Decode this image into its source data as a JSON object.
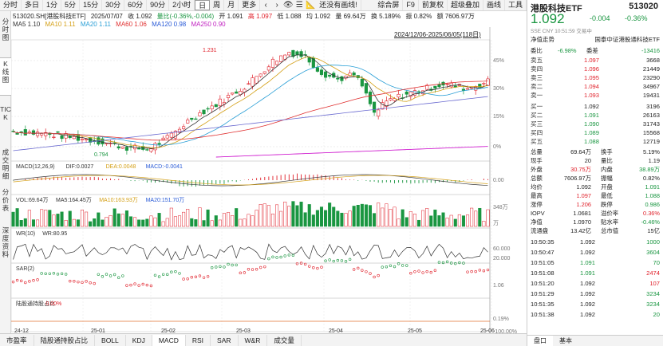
{
  "toolbar": {
    "items": [
      "分时",
      "多日",
      "1分",
      "5分",
      "15分",
      "30分",
      "60分",
      "90分",
      "2小时",
      "日",
      "周",
      "月",
      "更多"
    ],
    "active": "日",
    "restore_label": "还没有画线!",
    "right_items": [
      "综合屏",
      "F9",
      "前复权",
      "超级叠加",
      "画线",
      "工具"
    ]
  },
  "left_tabs": [
    "分时图",
    "K线图",
    "TICK",
    "成交明细",
    "分价表",
    "深度资料"
  ],
  "header": {
    "title": "513020.SH[港股科技ETF]",
    "date": "2025/07/07",
    "close": "收 1.092",
    "change": "量比(-0.36%,-0.004)",
    "open": "开 1.091",
    "high": "高 1.097",
    "low": "低 1.088",
    "avg": "均 1.092",
    "vol": "量 69.64万",
    "turnover": "换 5.189%",
    "amp": "振 0.82%",
    "amount": "额 7606.97万"
  },
  "ma": {
    "ma5": "MA5 1.10",
    "ma10": "MA10 1.11",
    "ma20": "MA20 1.11",
    "ma60": "MA60 1.06",
    "ma120": "MA120 0.98",
    "ma250": "MA250 0.90"
  },
  "range": "2024/12/06-2025/06/05(118日)",
  "price_labels": {
    "max": "1.231",
    "min": "0.794"
  },
  "right_axis": [
    "45%",
    "30%",
    "15%",
    "0%"
  ],
  "macd": {
    "label": "MACD(12,26,9)",
    "dif": "DIF:0.0027",
    "dea": "DEA:0.0048",
    "macd": "MACD:-0.0041",
    "axis": "0.00"
  },
  "vol": {
    "label": "VOL:69.64万",
    "ma5": "MA5:164.45万",
    "ma10": "MA10:163.93万",
    "ma20": "MA20:151.70万",
    "axis_top": "348万",
    "axis_bot": "万"
  },
  "wr": {
    "label": "WR(10)",
    "value": "WR:80.95",
    "axis": [
      "60.000",
      "20.000"
    ]
  },
  "sar": {
    "label": "SAR(2)",
    "axis": "1.06"
  },
  "hk": {
    "label": "陆股通持股占比",
    "value": "0.00%",
    "axis": [
      "0.19%",
      "-100.00%"
    ]
  },
  "x_axis": [
    "24-12",
    "25-01",
    "25-02",
    "25-03",
    "25-04",
    "25-05",
    "25-06"
  ],
  "bottom_tabs": [
    "市盈率",
    "陆股通持股占比",
    "BOLL",
    "KDJ",
    "MACD",
    "RSI",
    "SAR",
    "W&R",
    "成交量"
  ],
  "bottom_active": "MACD",
  "quote": {
    "name": "港股科技ETF",
    "code": "513020",
    "price": "1.092",
    "change": "-0.004",
    "pct": "-0.36%",
    "sub": "SSE CNY 10:51:59 交易中",
    "track_label": "净值走势",
    "index": "国泰中证港股通科技ETF",
    "weibi_label": "委比",
    "weibi": "-6.98%",
    "weicha_label": "委差",
    "weicha": "-13416",
    "sells": [
      [
        "卖五",
        "1.097",
        "3668"
      ],
      [
        "卖四",
        "1.096",
        "21449"
      ],
      [
        "卖三",
        "1.095",
        "23290"
      ],
      [
        "卖二",
        "1.094",
        "34967"
      ],
      [
        "卖一",
        "1.093",
        "19431"
      ]
    ],
    "buys": [
      [
        "买一",
        "1.092",
        "3196"
      ],
      [
        "买二",
        "1.091",
        "26163"
      ],
      [
        "买三",
        "1.090",
        "31743"
      ],
      [
        "买四",
        "1.089",
        "15568"
      ],
      [
        "买五",
        "1.088",
        "12719"
      ]
    ],
    "stats": [
      [
        "总量",
        "69.64万",
        "换手",
        "5.19%"
      ],
      [
        "现手",
        "20",
        "量比",
        "1.19"
      ],
      [
        "外盘",
        "30.75万",
        "内盘",
        "38.89万"
      ],
      [
        "总额",
        "7606.97万",
        "振幅",
        "0.82%"
      ],
      [
        "均价",
        "1.092",
        "开盘",
        "1.091"
      ],
      [
        "最高",
        "1.097",
        "最低",
        "1.088"
      ],
      [
        "涨停",
        "1.206",
        "跌停",
        "0.986"
      ],
      [
        "IOPV",
        "1.0681",
        "溢价率",
        "0.36%"
      ],
      [
        "净值",
        "1.0970",
        "贴水率",
        "-0.46%"
      ],
      [
        "流通盘",
        "13.42亿",
        "总市值",
        "15亿"
      ]
    ],
    "ticks": [
      [
        "10:50:35",
        "1.092",
        "1000"
      ],
      [
        "10:50:47",
        "1.092",
        "3604"
      ],
      [
        "10:51:05",
        "1.091",
        "70"
      ],
      [
        "10:51:08",
        "1.091",
        "2474"
      ],
      [
        "10:51:20",
        "1.092",
        "107"
      ],
      [
        "10:51:29",
        "1.092",
        "3234"
      ],
      [
        "10:51:35",
        "1.092",
        "3234"
      ],
      [
        "10:51:38",
        "1.092",
        "20"
      ]
    ],
    "panel_tabs": [
      "盘口",
      "基本"
    ]
  }
}
